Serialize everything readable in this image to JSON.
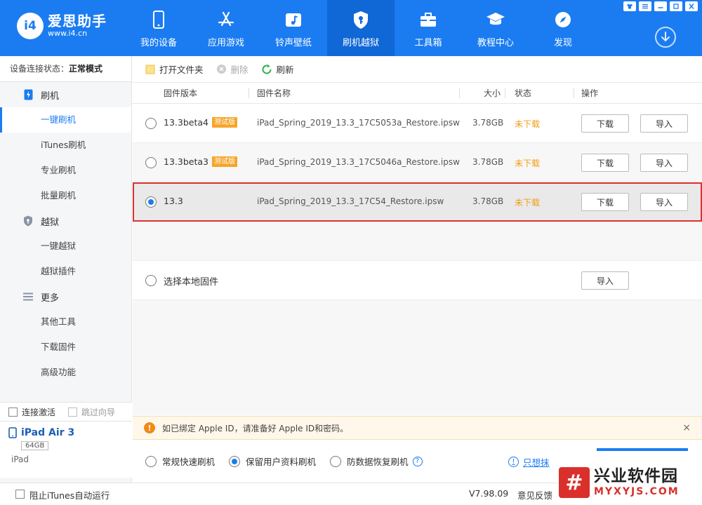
{
  "app": {
    "logo_badge": "i4",
    "logo_name": "爱思助手",
    "logo_url": "www.i4.cn"
  },
  "nav": [
    {
      "label": "我的设备",
      "icon": "phone-icon"
    },
    {
      "label": "应用游戏",
      "icon": "app-store-icon"
    },
    {
      "label": "铃声壁纸",
      "icon": "music-icon"
    },
    {
      "label": "刷机越狱",
      "icon": "shield-key-icon",
      "active": true
    },
    {
      "label": "工具箱",
      "icon": "toolbox-icon"
    },
    {
      "label": "教程中心",
      "icon": "graduation-cap-icon"
    },
    {
      "label": "发现",
      "icon": "compass-icon"
    }
  ],
  "sidebar": {
    "conn_label": "设备连接状态：",
    "conn_value": "正常模式",
    "groups": [
      {
        "label": "刷机",
        "items": [
          "一键刷机",
          "iTunes刷机",
          "专业刷机",
          "批量刷机"
        ]
      },
      {
        "label": "越狱",
        "items": [
          "一键越狱",
          "越狱插件"
        ]
      },
      {
        "label": "更多",
        "items": [
          "其他工具",
          "下载固件",
          "高级功能"
        ]
      }
    ],
    "check_connect": "连接激活",
    "check_skip": "跳过向导",
    "device_name": "iPad Air 3",
    "device_capacity": "64GB",
    "device_type": "iPad"
  },
  "toolbar": {
    "open_folder": "打开文件夹",
    "delete": "删除",
    "refresh": "刷新"
  },
  "table": {
    "headers": {
      "version": "固件版本",
      "name": "固件名称",
      "size": "大小",
      "status": "状态",
      "action": "操作"
    },
    "rows": [
      {
        "version": "13.3beta4",
        "tag": "测试版",
        "name": "iPad_Spring_2019_13.3_17C5053a_Restore.ipsw",
        "size": "3.78GB",
        "status": "未下载",
        "download": "下载",
        "import": "导入"
      },
      {
        "version": "13.3beta3",
        "tag": "测试版",
        "name": "iPad_Spring_2019_13.3_17C5046a_Restore.ipsw",
        "size": "3.78GB",
        "status": "未下载",
        "download": "下载",
        "import": "导入"
      },
      {
        "version": "13.3",
        "tag": "",
        "name": "iPad_Spring_2019_13.3_17C54_Restore.ipsw",
        "size": "3.78GB",
        "status": "未下载",
        "download": "下载",
        "import": "导入"
      }
    ],
    "local_label": "选择本地固件",
    "local_import": "导入"
  },
  "notice": {
    "text": "如已绑定 Apple ID，请准备好 Apple ID和密码。",
    "close": "×"
  },
  "modes": {
    "normal": "常规快速刷机",
    "keep": "保留用户资料刷机",
    "recovery": "防数据恢复刷机",
    "help": "?",
    "only_link": "只想抹"
  },
  "statusbar": {
    "itunes_check": "阻止iTunes自动运行",
    "version": "V7.98.09",
    "feedback": "意见反馈"
  },
  "watermark": {
    "logo": "#",
    "cn": "兴业软件园",
    "en": "MYXYJS.COM"
  },
  "colors": {
    "brand": "#1b7cf2",
    "status_orange": "#f39c12",
    "highlight_border": "#e0302f"
  }
}
